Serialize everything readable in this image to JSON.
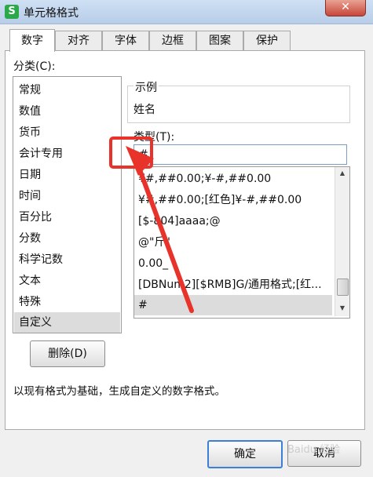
{
  "window": {
    "title": "单元格格式",
    "app_icon": "S",
    "close_glyph": "✕"
  },
  "tabs": [
    {
      "label": "数字",
      "active": true
    },
    {
      "label": "对齐"
    },
    {
      "label": "字体"
    },
    {
      "label": "边框"
    },
    {
      "label": "图案"
    },
    {
      "label": "保护"
    }
  ],
  "category": {
    "label": "分类(C):",
    "items": [
      "常规",
      "数值",
      "货币",
      "会计专用",
      "日期",
      "时间",
      "百分比",
      "分数",
      "科学记数",
      "文本",
      "特殊",
      "自定义"
    ],
    "selected": "自定义"
  },
  "sample": {
    "legend": "示例",
    "value": "姓名"
  },
  "type": {
    "label": "类型(T):",
    "value": "#",
    "formats": [
      "¥#,##0.00;¥-#,##0.00",
      "¥#,##0.00;[红色]¥-#,##0.00",
      "[$-804]aaaa;@",
      "@\"斤\"",
      "0.00_",
      "[DBNum2][$RMB]G/通用格式;[红...",
      "#"
    ],
    "selected": "#"
  },
  "buttons": {
    "delete": "删除(D)",
    "ok": "确定",
    "cancel": "取消"
  },
  "description": "以现有格式为基础，生成自定义的数字格式。",
  "watermark": "Baidu 经验",
  "colors": {
    "annotation": "#e8332a",
    "selection": "#dcdcdc",
    "input_border": "#7a9cc5"
  }
}
